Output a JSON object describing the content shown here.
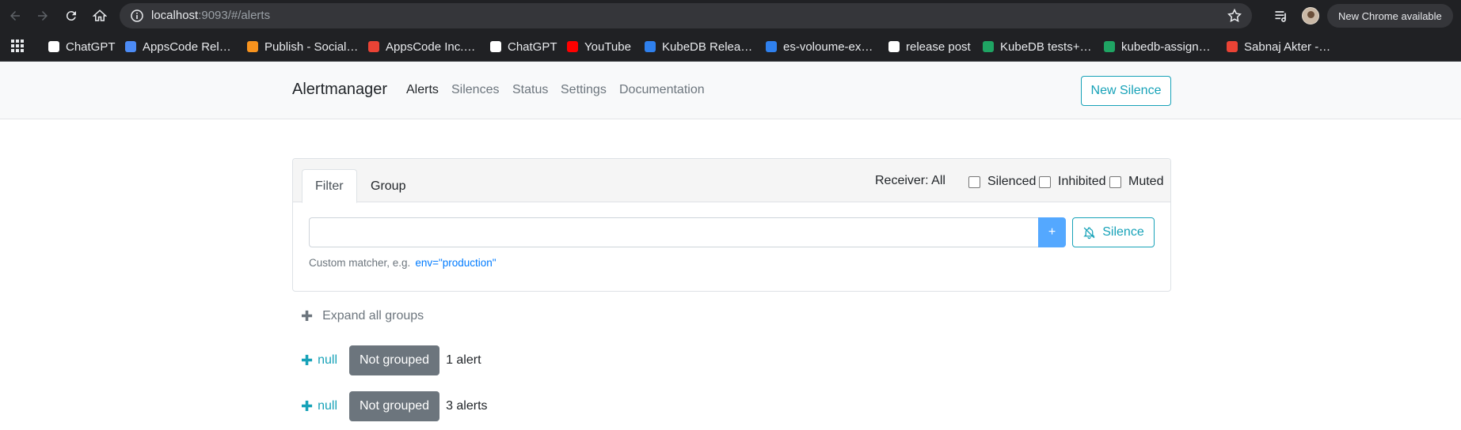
{
  "browser": {
    "url_host": "localhost",
    "url_rest": ":9093/#/alerts",
    "update_label": "New Chrome available"
  },
  "bookmarks": [
    {
      "label": "ChatGPT",
      "icon": "chatgpt-icon",
      "color": "#ffffff"
    },
    {
      "label": "AppsCode Rel…",
      "icon": "people-icon",
      "color": "#4c8bf5"
    },
    {
      "label": "Publish - Social…",
      "icon": "publish-icon",
      "color": "#f7931e"
    },
    {
      "label": "AppsCode Inc.…",
      "icon": "gmail-icon",
      "color": "#ea4335"
    },
    {
      "label": "ChatGPT",
      "icon": "chatgpt-icon",
      "color": "#ffffff"
    },
    {
      "label": "YouTube",
      "icon": "youtube-icon",
      "color": "#ff0000"
    },
    {
      "label": "KubeDB Relea…",
      "icon": "canva-icon",
      "color": "#2f80ed"
    },
    {
      "label": "es-voloume-ex…",
      "icon": "canva-icon",
      "color": "#2f80ed"
    },
    {
      "label": "release post",
      "icon": "github-icon",
      "color": "#ffffff"
    },
    {
      "label": "KubeDB tests+…",
      "icon": "sheets-icon",
      "color": "#1fa463"
    },
    {
      "label": "kubedb-assign…",
      "icon": "sheets-icon",
      "color": "#1fa463"
    },
    {
      "label": "Sabnaj Akter -…",
      "icon": "gmail-icon",
      "color": "#ea4335"
    }
  ],
  "navbar": {
    "brand": "Alertmanager",
    "links": [
      "Alerts",
      "Silences",
      "Status",
      "Settings",
      "Documentation"
    ],
    "new_silence": "New Silence"
  },
  "filter": {
    "tabs": [
      "Filter",
      "Group"
    ],
    "receiver": "Receiver: All",
    "checkboxes": [
      "Silenced",
      "Inhibited",
      "Muted"
    ],
    "input_value": "",
    "plus_label": "+",
    "silence_label": "Silence",
    "hint": "Custom matcher, e.g.",
    "hint_example": "env=\"production\""
  },
  "alerts": {
    "expand_all": "Expand all groups",
    "groups": [
      {
        "name": "null",
        "badge": "Not grouped",
        "count": "1 alert"
      },
      {
        "name": "null",
        "badge": "Not grouped",
        "count": "3 alerts"
      }
    ]
  },
  "colors": {
    "accent": "#17a2b8",
    "primary_button": "#54a8ff",
    "badge": "#6c757d",
    "link": "#007bff"
  }
}
